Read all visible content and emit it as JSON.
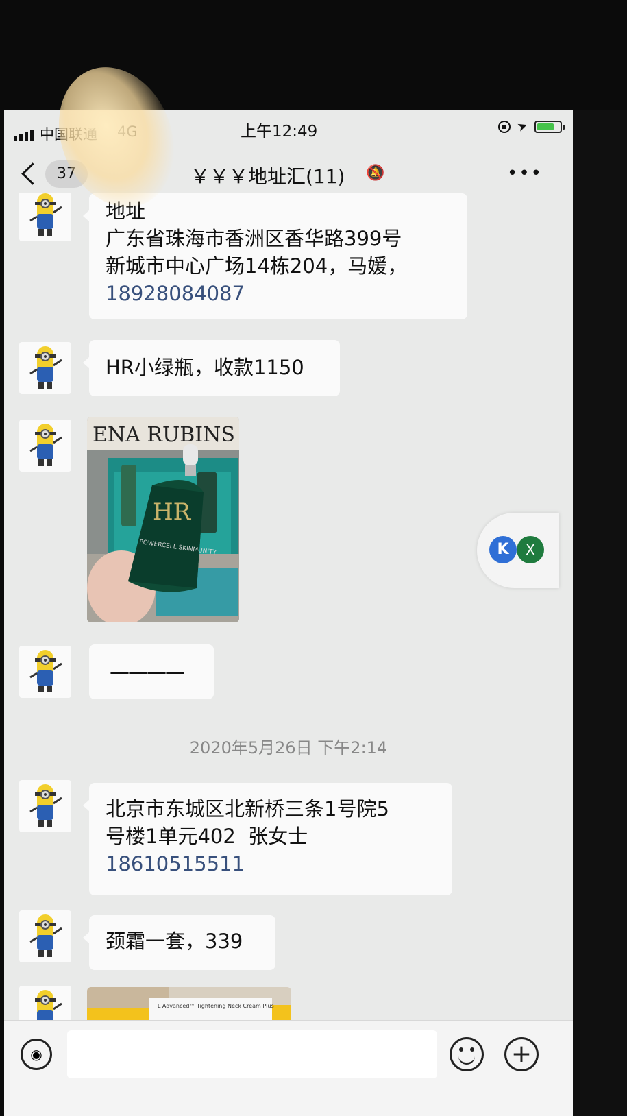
{
  "status_bar": {
    "carrier": "中国联通",
    "network": "4G",
    "time": "上午12:49",
    "battery_color": "#45c24a"
  },
  "nav": {
    "back_count": "37",
    "title": "￥￥￥地址汇(11)",
    "mute_icon": "bell-slash-icon",
    "more": "•••"
  },
  "messages": [
    {
      "type": "text",
      "lines": [
        "地址",
        "广东省珠海市香洲区香华路399号",
        "新城市中心广场14栋204，马媛，"
      ],
      "phone": "18928084087"
    },
    {
      "type": "text",
      "lines": [
        "HR小绿瓶，收款1150"
      ]
    },
    {
      "type": "image",
      "label": "ENA RUBINS",
      "bottle_logo": "HR",
      "bottle_text": "POWERCELL SKINMUNITY"
    },
    {
      "type": "text",
      "lines": [
        "————"
      ]
    },
    {
      "type": "timestamp",
      "text": "2020年5月26日 下午2:14"
    },
    {
      "type": "text",
      "lines": [
        "北京市东城区北新桥三条1号院5",
        "号楼1单元402  张女士"
      ],
      "phone": "18610515511"
    },
    {
      "type": "text",
      "lines": [
        "颈霜一套，339"
      ]
    },
    {
      "type": "image",
      "label": "TL Advanced™ Tightening Neck Cream Plus"
    }
  ],
  "floating": {
    "k_label": "K",
    "x_label": "X"
  },
  "input_bar": {
    "voice_icon": "voice-icon",
    "emoji_icon": "emoji-icon",
    "plus_icon": "plus-icon",
    "plus": "+",
    "voice": "◉"
  }
}
